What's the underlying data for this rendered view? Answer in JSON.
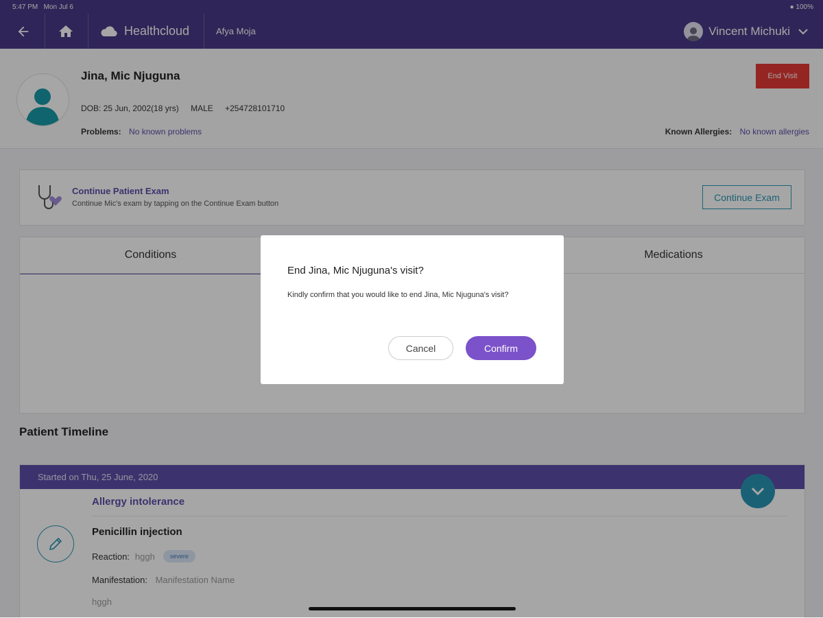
{
  "statusbar": {
    "time": "5:47 PM",
    "date": "Mon Jul 6",
    "battery": "100%"
  },
  "navbar": {
    "brand": "Healthcloud",
    "org": "Afya Moja",
    "user": "Vincent Michuki"
  },
  "patient": {
    "name": "Jina, Mic Njuguna",
    "dob": "DOB: 25 Jun, 2002(18 yrs)",
    "gender": "MALE",
    "phone": "+254728101710",
    "problems_label": "Problems:",
    "problems_value": "No known problems",
    "allergies_label": "Known Allergies:",
    "allergies_value": "No known allergies",
    "end_visit": "End Visit"
  },
  "exam": {
    "title": "Continue Patient Exam",
    "subtitle": "Continue Mic's exam by tapping on the Continue Exam button",
    "button": "Continue Exam"
  },
  "tabs": [
    {
      "label": "Conditions"
    },
    {
      "label": "Medications"
    }
  ],
  "timeline": {
    "title": "Patient Timeline",
    "started": "Started on Thu, 25 June, 2020",
    "category": "Allergy intolerance",
    "item": "Penicillin injection",
    "reaction_label": "Reaction:",
    "reaction_value": "hggh",
    "severity": "severe",
    "manifestation_label": "Manifestation:",
    "manifestation_value": "Manifestation Name",
    "note": "hggh"
  },
  "dialog": {
    "title": "End Jina, Mic Njuguna's visit?",
    "message": "Kindly confirm that you would like to end Jina, Mic Njuguna's visit?",
    "cancel": "Cancel",
    "confirm": "Confirm"
  },
  "colors": {
    "brand": "#4a3a88",
    "accent": "#5d4ea8",
    "teal": "#2a96b4",
    "danger": "#e53935",
    "confirm": "#7b52c9"
  }
}
